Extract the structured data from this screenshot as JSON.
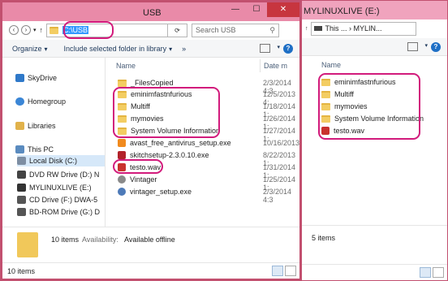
{
  "left_window": {
    "title": "USB",
    "address": "C:\\USB",
    "search_placeholder": "Search USB",
    "toolbar": {
      "organize": "Organize",
      "include_library": "Include selected folder in library",
      "more": "»"
    },
    "nav": [
      {
        "label": "SkyDrive"
      },
      {
        "label": "Homegroup"
      },
      {
        "label": "Libraries"
      },
      {
        "label": "This PC"
      },
      {
        "label": "Local Disk (C:)"
      },
      {
        "label": "DVD RW Drive (D:) N"
      },
      {
        "label": "MYLINUXLIVE (E:)"
      },
      {
        "label": "CD Drive (F:) DWA-5"
      },
      {
        "label": "BD-ROM Drive (G:) D"
      }
    ],
    "columns": {
      "name": "Name",
      "date": "Date m"
    },
    "files": [
      {
        "name": "_FilesCopied",
        "date": "2/3/2014 4:3",
        "kind": "folder"
      },
      {
        "name": "eminimfastnfurious",
        "date": "12/5/2013 4:",
        "kind": "folder"
      },
      {
        "name": "Multiff",
        "date": "1/18/2014 1:",
        "kind": "folder"
      },
      {
        "name": "mymovies",
        "date": "1/26/2014 1:",
        "kind": "folder"
      },
      {
        "name": "System Volume Information",
        "date": "1/27/2014 1:",
        "kind": "folder"
      },
      {
        "name": "avast_free_antivirus_setup.exe",
        "date": "10/16/2013",
        "kind": "exe"
      },
      {
        "name": "skitchsetup-2.3.0.10.exe",
        "date": "8/22/2013 1:",
        "kind": "exe"
      },
      {
        "name": "testo.wav",
        "date": "1/31/2014 1:",
        "kind": "wav"
      },
      {
        "name": "Vintager",
        "date": "1/25/2014 1:",
        "kind": "exe"
      },
      {
        "name": "vintager_setup.exe",
        "date": "2/3/2014 4:3",
        "kind": "exe"
      }
    ],
    "details": {
      "count": "10 items",
      "availability_label": "Availability:",
      "availability_value": "Available offline"
    },
    "status": "10 items"
  },
  "right_window": {
    "title": "MYLINUXLIVE (E:)",
    "path": "This ... › MYLIN...",
    "columns": {
      "name": "Name"
    },
    "files": [
      {
        "name": "eminimfastnfurious",
        "kind": "folder"
      },
      {
        "name": "Multiff",
        "kind": "folder"
      },
      {
        "name": "mymovies",
        "kind": "folder"
      },
      {
        "name": "System Volume Information",
        "kind": "folder"
      },
      {
        "name": "testo.wav",
        "kind": "wav"
      }
    ],
    "details": {
      "count": "5 items"
    }
  },
  "colors": {
    "titlebar": "#e98aa8",
    "highlight_ring": "#d21b7c",
    "close": "#c7353f",
    "folder": "#f3cd62"
  },
  "icons": [
    "back-icon",
    "forward-icon",
    "up-icon",
    "search-icon",
    "help-icon",
    "folder-icon",
    "drive-icon",
    "wav-icon"
  ]
}
